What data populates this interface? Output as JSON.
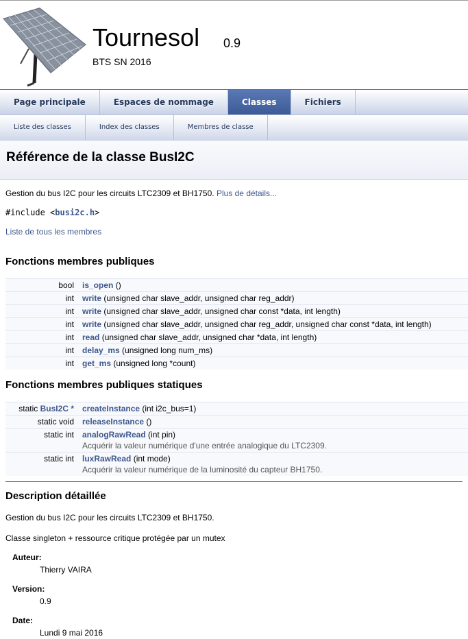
{
  "project": {
    "name": "Tournesol",
    "number": "0.9",
    "brief": "BTS SN 2016"
  },
  "tabs": [
    {
      "label": "Page principale",
      "active": false
    },
    {
      "label": "Espaces de nommage",
      "active": false
    },
    {
      "label": "Classes",
      "active": true
    },
    {
      "label": "Fichiers",
      "active": false
    }
  ],
  "subtabs": [
    {
      "label": "Liste des classes"
    },
    {
      "label": "Index des classes"
    },
    {
      "label": "Membres de classe"
    }
  ],
  "title": "Référence de la classe BusI2C",
  "brief": {
    "text": "Gestion du bus I2C pour les circuits LTC2309 et BH1750.",
    "more": "Plus de détails..."
  },
  "include": {
    "prefix": "#include <",
    "file": "busi2c.h",
    "suffix": ">"
  },
  "all_members": "Liste de tous les membres",
  "public_functions": {
    "heading": "Fonctions membres publiques",
    "rows": [
      {
        "type": "bool",
        "name": "is_open",
        "args": " ()"
      },
      {
        "type": "int",
        "name": "write",
        "args": " (unsigned char slave_addr, unsigned char reg_addr)"
      },
      {
        "type": "int",
        "name": "write",
        "args": " (unsigned char slave_addr, unsigned char const *data, int length)"
      },
      {
        "type": "int",
        "name": "write",
        "args": " (unsigned char slave_addr, unsigned char reg_addr, unsigned char const *data, int length)"
      },
      {
        "type": "int",
        "name": "read",
        "args": " (unsigned char slave_addr, unsigned char *data, int length)"
      },
      {
        "type": "int",
        "name": "delay_ms",
        "args": " (unsigned long num_ms)"
      },
      {
        "type": "int",
        "name": "get_ms",
        "args": " (unsigned long *count)"
      }
    ]
  },
  "static_functions": {
    "heading": "Fonctions membres publiques statiques",
    "rows": [
      {
        "type_prefix": "static ",
        "type_link": "BusI2C",
        "type_suffix": " *",
        "name": "createInstance",
        "args": " (int i2c_bus=1)",
        "desc": ""
      },
      {
        "type_prefix": "static void",
        "type_link": "",
        "type_suffix": "",
        "name": "releaseInstance",
        "args": " ()",
        "desc": ""
      },
      {
        "type_prefix": "static int",
        "type_link": "",
        "type_suffix": "",
        "name": "analogRawRead",
        "args": " (int pin)",
        "desc": "Acquérir la valeur numérique d'une entrée analogique du LTC2309."
      },
      {
        "type_prefix": "static int",
        "type_link": "",
        "type_suffix": "",
        "name": "luxRawRead",
        "args": " (int mode)",
        "desc": "Acquérir la valeur numérique de la luminosité du capteur BH1750."
      }
    ]
  },
  "detail": {
    "heading": "Description détaillée",
    "p1": "Gestion du bus I2C pour les circuits LTC2309 et BH1750.",
    "p2": "Classe singleton + ressource critique protégée par un mutex",
    "fields": [
      {
        "label": "Auteur:",
        "value": "Thierry VAIRA"
      },
      {
        "label": "Version:",
        "value": "0.9"
      },
      {
        "label": "Date:",
        "value": "Lundi 9 mai 2016"
      }
    ]
  },
  "colors": {
    "link": "#3d578c",
    "tab_active": "#4665a2",
    "row_bg": "#f8f9fc"
  },
  "icons": {
    "logo": "solar-panel-logo"
  }
}
